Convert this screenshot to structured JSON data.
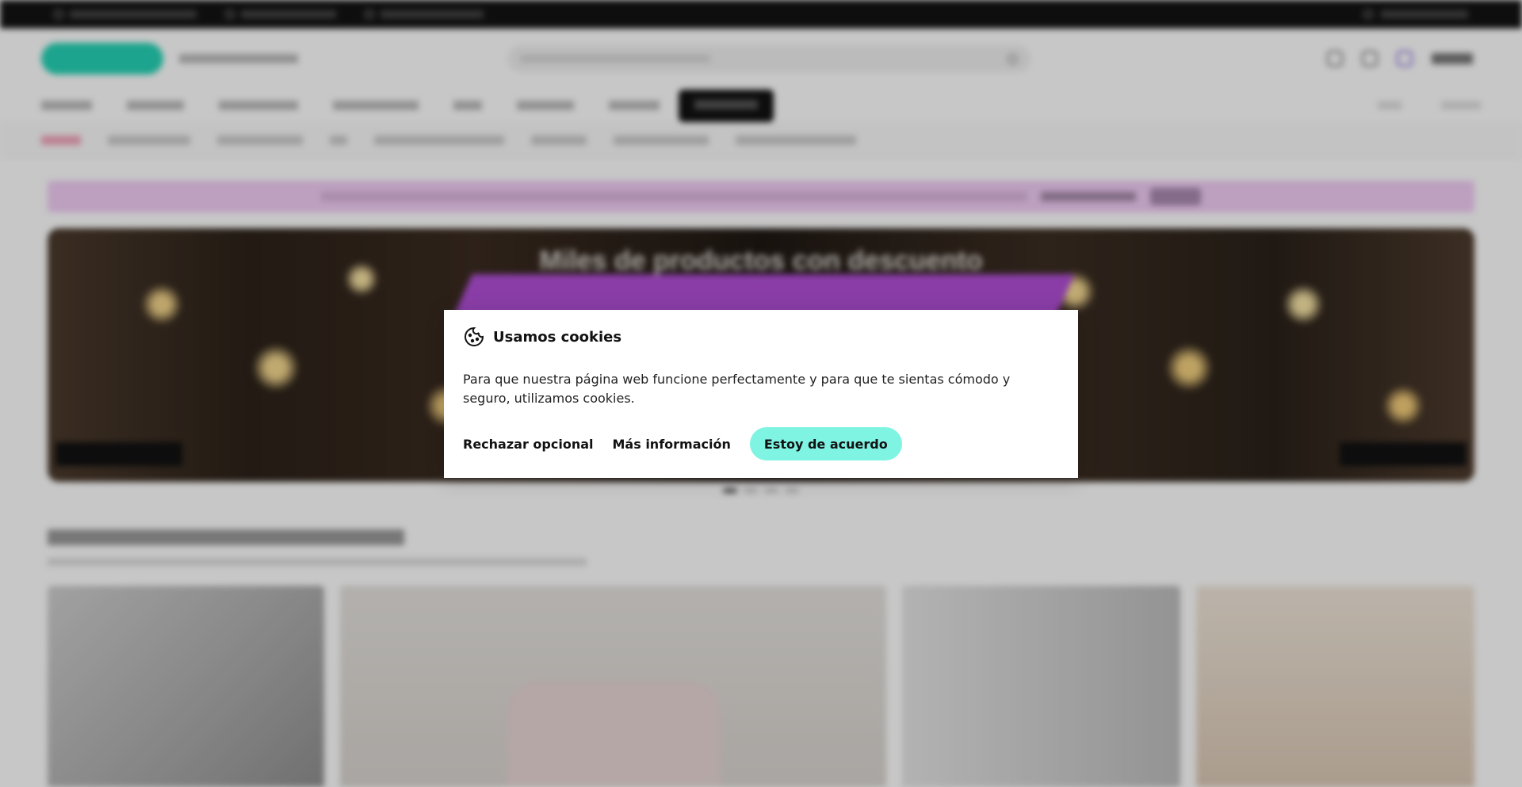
{
  "colors": {
    "accent": "#7ff4e2",
    "brand": "#25d3b6",
    "promo_bg": "#f2cdf6",
    "topbar_bg": "#131313"
  },
  "cookie_dialog": {
    "title": "Usamos cookies",
    "icon": "cookie-icon",
    "body": "Para que nuestra página web funcione perfectamente y para que te sientas cómodo y seguro, utilizamos cookies.",
    "reject_label": "Rechazar opcional",
    "more_info_label": "Más información",
    "accept_label": "Estoy de acuerdo"
  },
  "hero": {
    "title": "Miles de productos con descuento"
  }
}
